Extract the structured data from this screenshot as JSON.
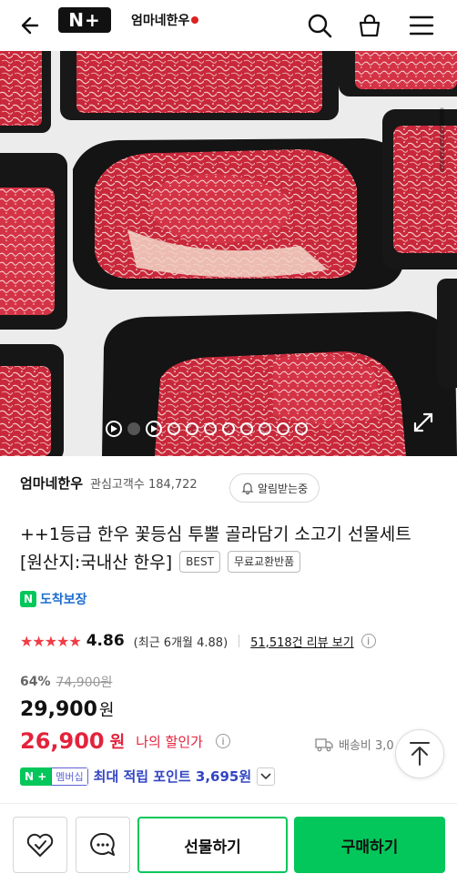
{
  "header": {
    "nplus_label": "N+",
    "logo_text": "엄마네한우"
  },
  "colors": {
    "naver_green": "#03c75a",
    "sale_red": "#e3233c",
    "star_red": "#ef3d45",
    "points_blue": "#3345c4"
  },
  "gallery": {
    "slide_count": 10,
    "active_index": 0
  },
  "seller": {
    "name": "엄마네한우",
    "fans_label": "관심고객수 184,722",
    "alarm_label": "알림받는중"
  },
  "product": {
    "title": "++1등급 한우 꽃등심 투뿔 골라담기 소고기 선물세트 [원산지:국내산 한우]",
    "tag_best": "BEST",
    "tag_exchange": "무료교환반품",
    "delivery_badge": "N",
    "delivery_label": "도착보장"
  },
  "rating": {
    "stars": "★★★★★",
    "score": "4.86",
    "recent": "(최근 6개월 4.88)",
    "review_link": "51,518건 리뷰 보기",
    "info": "i"
  },
  "price": {
    "discount_pct": "64%",
    "original": "74,900원",
    "sale": "29,900",
    "won": "원",
    "my_price": "26,900",
    "my_price_won": "원",
    "my_price_label": "나의 할인가",
    "shipping": "배송비 3,0"
  },
  "points": {
    "badge_np": "N +",
    "badge_membership": "멤버십",
    "text": "최대 적립 포인트 3,695원"
  },
  "actions": {
    "gift": "선물하기",
    "buy": "구매하기"
  }
}
